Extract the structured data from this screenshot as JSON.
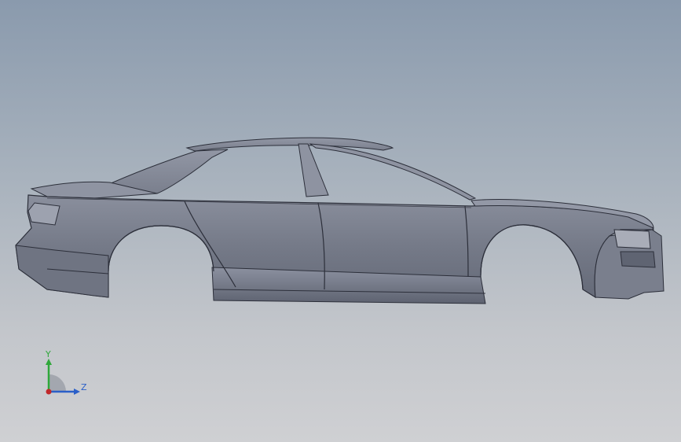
{
  "viewport": {
    "background_top": "#8a9aad",
    "background_bottom": "#cfd0d3"
  },
  "model": {
    "body_color": "#7e8391",
    "edge_color": "#2c2f3a"
  },
  "triad": {
    "y_label": "Y",
    "z_label": "Z",
    "y_color": "#2fa83a",
    "z_color": "#2a5fc8",
    "x_color": "#c0282a"
  }
}
